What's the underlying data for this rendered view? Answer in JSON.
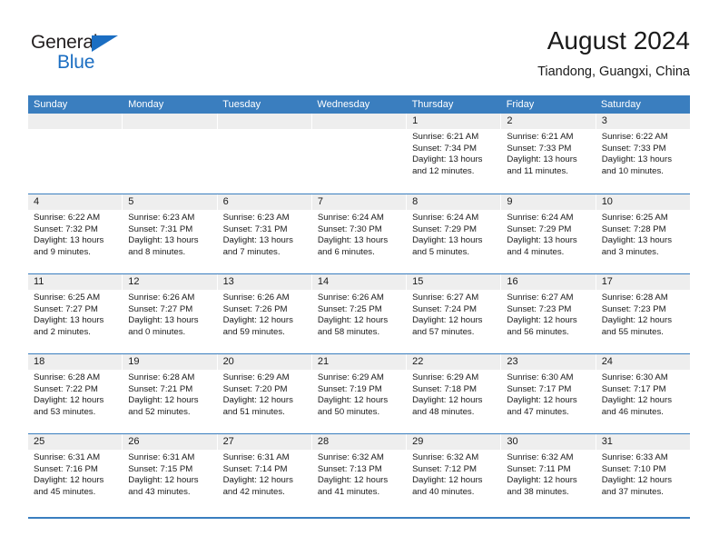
{
  "brand": {
    "name_top": "General",
    "name_bottom": "Blue",
    "triangle_color": "#1b6ec2",
    "text_color": "#231f20"
  },
  "header": {
    "title": "August 2024",
    "subtitle": "Tiandong, Guangxi, China"
  },
  "theme": {
    "header_blue": "#3a7ebf",
    "day_band_gray": "#eeeeee",
    "text": "#1a1a1a"
  },
  "weekdays": [
    "Sunday",
    "Monday",
    "Tuesday",
    "Wednesday",
    "Thursday",
    "Friday",
    "Saturday"
  ],
  "weeks": [
    [
      {
        "day": "",
        "empty": true
      },
      {
        "day": "",
        "empty": true
      },
      {
        "day": "",
        "empty": true
      },
      {
        "day": "",
        "empty": true
      },
      {
        "day": "1",
        "sunrise": "Sunrise: 6:21 AM",
        "sunset": "Sunset: 7:34 PM",
        "daylight_l1": "Daylight: 13 hours",
        "daylight_l2": "and 12 minutes."
      },
      {
        "day": "2",
        "sunrise": "Sunrise: 6:21 AM",
        "sunset": "Sunset: 7:33 PM",
        "daylight_l1": "Daylight: 13 hours",
        "daylight_l2": "and 11 minutes."
      },
      {
        "day": "3",
        "sunrise": "Sunrise: 6:22 AM",
        "sunset": "Sunset: 7:33 PM",
        "daylight_l1": "Daylight: 13 hours",
        "daylight_l2": "and 10 minutes."
      }
    ],
    [
      {
        "day": "4",
        "sunrise": "Sunrise: 6:22 AM",
        "sunset": "Sunset: 7:32 PM",
        "daylight_l1": "Daylight: 13 hours",
        "daylight_l2": "and 9 minutes."
      },
      {
        "day": "5",
        "sunrise": "Sunrise: 6:23 AM",
        "sunset": "Sunset: 7:31 PM",
        "daylight_l1": "Daylight: 13 hours",
        "daylight_l2": "and 8 minutes."
      },
      {
        "day": "6",
        "sunrise": "Sunrise: 6:23 AM",
        "sunset": "Sunset: 7:31 PM",
        "daylight_l1": "Daylight: 13 hours",
        "daylight_l2": "and 7 minutes."
      },
      {
        "day": "7",
        "sunrise": "Sunrise: 6:24 AM",
        "sunset": "Sunset: 7:30 PM",
        "daylight_l1": "Daylight: 13 hours",
        "daylight_l2": "and 6 minutes."
      },
      {
        "day": "8",
        "sunrise": "Sunrise: 6:24 AM",
        "sunset": "Sunset: 7:29 PM",
        "daylight_l1": "Daylight: 13 hours",
        "daylight_l2": "and 5 minutes."
      },
      {
        "day": "9",
        "sunrise": "Sunrise: 6:24 AM",
        "sunset": "Sunset: 7:29 PM",
        "daylight_l1": "Daylight: 13 hours",
        "daylight_l2": "and 4 minutes."
      },
      {
        "day": "10",
        "sunrise": "Sunrise: 6:25 AM",
        "sunset": "Sunset: 7:28 PM",
        "daylight_l1": "Daylight: 13 hours",
        "daylight_l2": "and 3 minutes."
      }
    ],
    [
      {
        "day": "11",
        "sunrise": "Sunrise: 6:25 AM",
        "sunset": "Sunset: 7:27 PM",
        "daylight_l1": "Daylight: 13 hours",
        "daylight_l2": "and 2 minutes."
      },
      {
        "day": "12",
        "sunrise": "Sunrise: 6:26 AM",
        "sunset": "Sunset: 7:27 PM",
        "daylight_l1": "Daylight: 13 hours",
        "daylight_l2": "and 0 minutes."
      },
      {
        "day": "13",
        "sunrise": "Sunrise: 6:26 AM",
        "sunset": "Sunset: 7:26 PM",
        "daylight_l1": "Daylight: 12 hours",
        "daylight_l2": "and 59 minutes."
      },
      {
        "day": "14",
        "sunrise": "Sunrise: 6:26 AM",
        "sunset": "Sunset: 7:25 PM",
        "daylight_l1": "Daylight: 12 hours",
        "daylight_l2": "and 58 minutes."
      },
      {
        "day": "15",
        "sunrise": "Sunrise: 6:27 AM",
        "sunset": "Sunset: 7:24 PM",
        "daylight_l1": "Daylight: 12 hours",
        "daylight_l2": "and 57 minutes."
      },
      {
        "day": "16",
        "sunrise": "Sunrise: 6:27 AM",
        "sunset": "Sunset: 7:23 PM",
        "daylight_l1": "Daylight: 12 hours",
        "daylight_l2": "and 56 minutes."
      },
      {
        "day": "17",
        "sunrise": "Sunrise: 6:28 AM",
        "sunset": "Sunset: 7:23 PM",
        "daylight_l1": "Daylight: 12 hours",
        "daylight_l2": "and 55 minutes."
      }
    ],
    [
      {
        "day": "18",
        "sunrise": "Sunrise: 6:28 AM",
        "sunset": "Sunset: 7:22 PM",
        "daylight_l1": "Daylight: 12 hours",
        "daylight_l2": "and 53 minutes."
      },
      {
        "day": "19",
        "sunrise": "Sunrise: 6:28 AM",
        "sunset": "Sunset: 7:21 PM",
        "daylight_l1": "Daylight: 12 hours",
        "daylight_l2": "and 52 minutes."
      },
      {
        "day": "20",
        "sunrise": "Sunrise: 6:29 AM",
        "sunset": "Sunset: 7:20 PM",
        "daylight_l1": "Daylight: 12 hours",
        "daylight_l2": "and 51 minutes."
      },
      {
        "day": "21",
        "sunrise": "Sunrise: 6:29 AM",
        "sunset": "Sunset: 7:19 PM",
        "daylight_l1": "Daylight: 12 hours",
        "daylight_l2": "and 50 minutes."
      },
      {
        "day": "22",
        "sunrise": "Sunrise: 6:29 AM",
        "sunset": "Sunset: 7:18 PM",
        "daylight_l1": "Daylight: 12 hours",
        "daylight_l2": "and 48 minutes."
      },
      {
        "day": "23",
        "sunrise": "Sunrise: 6:30 AM",
        "sunset": "Sunset: 7:17 PM",
        "daylight_l1": "Daylight: 12 hours",
        "daylight_l2": "and 47 minutes."
      },
      {
        "day": "24",
        "sunrise": "Sunrise: 6:30 AM",
        "sunset": "Sunset: 7:17 PM",
        "daylight_l1": "Daylight: 12 hours",
        "daylight_l2": "and 46 minutes."
      }
    ],
    [
      {
        "day": "25",
        "sunrise": "Sunrise: 6:31 AM",
        "sunset": "Sunset: 7:16 PM",
        "daylight_l1": "Daylight: 12 hours",
        "daylight_l2": "and 45 minutes."
      },
      {
        "day": "26",
        "sunrise": "Sunrise: 6:31 AM",
        "sunset": "Sunset: 7:15 PM",
        "daylight_l1": "Daylight: 12 hours",
        "daylight_l2": "and 43 minutes."
      },
      {
        "day": "27",
        "sunrise": "Sunrise: 6:31 AM",
        "sunset": "Sunset: 7:14 PM",
        "daylight_l1": "Daylight: 12 hours",
        "daylight_l2": "and 42 minutes."
      },
      {
        "day": "28",
        "sunrise": "Sunrise: 6:32 AM",
        "sunset": "Sunset: 7:13 PM",
        "daylight_l1": "Daylight: 12 hours",
        "daylight_l2": "and 41 minutes."
      },
      {
        "day": "29",
        "sunrise": "Sunrise: 6:32 AM",
        "sunset": "Sunset: 7:12 PM",
        "daylight_l1": "Daylight: 12 hours",
        "daylight_l2": "and 40 minutes."
      },
      {
        "day": "30",
        "sunrise": "Sunrise: 6:32 AM",
        "sunset": "Sunset: 7:11 PM",
        "daylight_l1": "Daylight: 12 hours",
        "daylight_l2": "and 38 minutes."
      },
      {
        "day": "31",
        "sunrise": "Sunrise: 6:33 AM",
        "sunset": "Sunset: 7:10 PM",
        "daylight_l1": "Daylight: 12 hours",
        "daylight_l2": "and 37 minutes."
      }
    ]
  ]
}
